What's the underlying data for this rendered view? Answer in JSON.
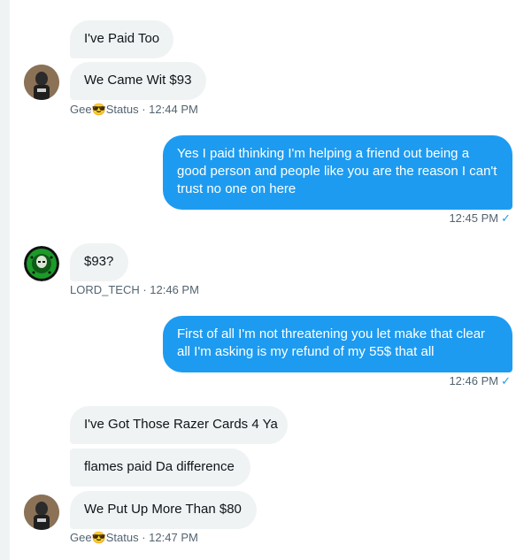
{
  "messages": {
    "m1": "I've Paid Too",
    "m2": "We Came Wit $93",
    "meta1_name": "Gee",
    "meta1_emoji": "😎",
    "meta1_rest": "Status · 12:44 PM",
    "m3": "Yes I paid thinking I'm helping a friend out being a good person and people like you are the reason I can't trust no one on here",
    "meta3_time": "12:45 PM",
    "m4": "$93?",
    "meta4": "LORD_TECH · 12:46 PM",
    "m5": "First of all I'm not threatening you let make that clear all I'm asking is my refund of my 55$ that all",
    "meta5_time": "12:46 PM",
    "m6": "I've Got Those Razer Cards 4 Ya",
    "m7": "flames paid Da difference",
    "m8": "We Put Up More Than $80",
    "meta8_name": "Gee",
    "meta8_emoji": "😎",
    "meta8_rest": "Status · 12:47 PM"
  },
  "icons": {
    "sent_check": "✓"
  },
  "colors": {
    "outgoing": "#1d9bf0",
    "incoming": "#eff3f4",
    "meta_text": "#536471"
  }
}
